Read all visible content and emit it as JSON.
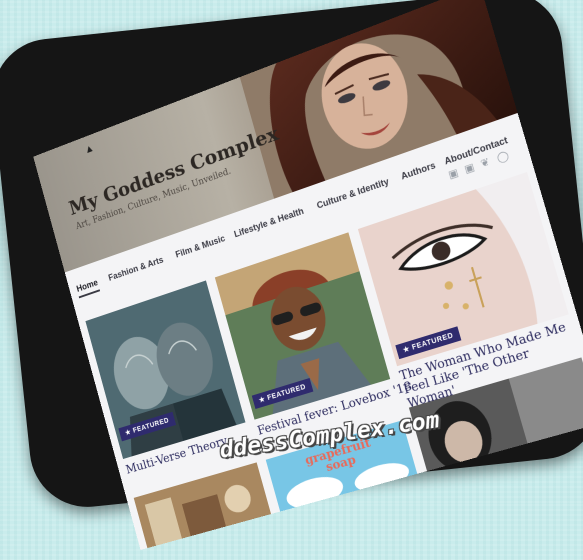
{
  "site": {
    "title": "My Goddess Complex",
    "tagline": "Art, Fashion, Culture, Music, Unveiled."
  },
  "nav": {
    "items": [
      "Home",
      "Fashion & Arts",
      "Film & Music",
      "Lifestyle & Health",
      "Culture & Identity",
      "Authors",
      "About/Contact"
    ],
    "social_icons": [
      "facebook-icon",
      "linkedin-icon",
      "twitter-icon",
      "instagram-icon"
    ]
  },
  "posts": [
    {
      "badge": "★ FEATURED",
      "title": "Multi-Verse Theory"
    },
    {
      "badge": "★ FEATURED",
      "title": "Festival fever: Lovebox '18"
    },
    {
      "badge": "★ FEATURED",
      "title": "The Woman Who Made Me Feel Like 'The Other Woman'"
    }
  ],
  "lower_row": {
    "middle_text": "grapefruit soap"
  },
  "watermark": "ddessComplex.com",
  "colors": {
    "background": "#c9ecec",
    "device": "#151515",
    "accent_badge": "#2f2b6e",
    "title_text": "#2b2a5e"
  }
}
